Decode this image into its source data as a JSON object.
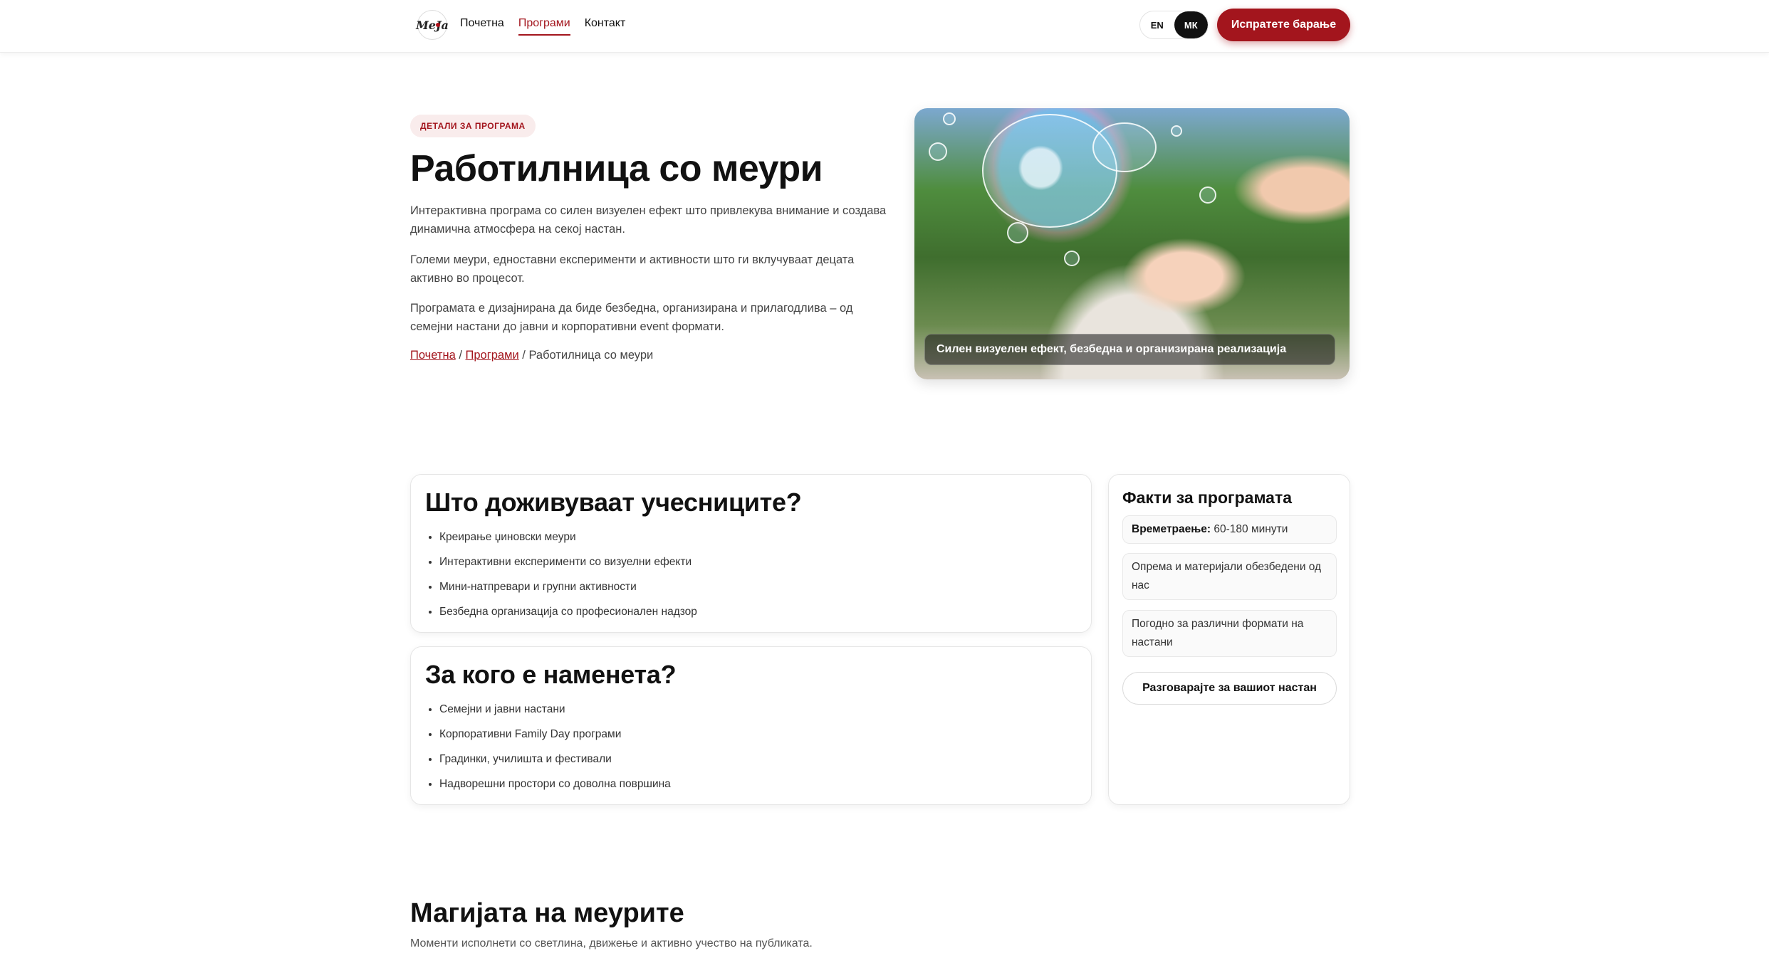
{
  "header": {
    "logo_text": "MeJa",
    "nav": [
      {
        "label": "Почетна",
        "active": false
      },
      {
        "label": "Програми",
        "active": true
      },
      {
        "label": "Контакт",
        "active": false
      }
    ],
    "lang": {
      "en": "EN",
      "mk": "МК",
      "selected": "МК"
    },
    "cta": "Испратете барање"
  },
  "hero": {
    "badge": "ДЕТАЛИ ЗА ПРОГРАМА",
    "title": "Работилница со меури",
    "p1": "Интерактивна програма со силен визуелен ефект што привлекува внимание и создава динамична атмосфера на секој настан.",
    "p2": "Големи меури, едноставни експерименти и активности што ги вклучуваат децата активно во процесот.",
    "p3": "Програмата е дизајнирана да биде безбедна, организирана и прилагодлива – од семејни настани до јавни и корпоративни event формати.",
    "breadcrumb": {
      "home": "Почетна",
      "sep": " / ",
      "programs": "Програми",
      "current": "Работилница со меури"
    },
    "image_caption": "Силен визуелен ефект, безбедна и организирана реализација"
  },
  "experience": {
    "title": "Што доживуваат учесниците?",
    "items": [
      "Креирање џиновски меури",
      "Интерактивни експерименти со визуелни ефекти",
      "Мини-натпревари и групни активности",
      "Безбедна организација со професионален надзор"
    ]
  },
  "audience": {
    "title": "За кого е наменета?",
    "items": [
      "Семејни и јавни настани",
      "Корпоративни Family Day програми",
      "Градинки, училишта и фестивали",
      "Надворешни простори со доволна површина"
    ]
  },
  "facts": {
    "title": "Факти за програмата",
    "duration_label": "Времетраење:",
    "duration_value": " 60-180 минути",
    "fact2": "Опрема и материјали обезбедени од нас",
    "fact3": "Погодно за различни формати на настани",
    "button": "Разговарајте за вашиот настан"
  },
  "magic": {
    "title": "Магијата на меурите",
    "subtitle": "Моменти исполнети со светлина, движење и активно учество на публиката."
  },
  "colors": {
    "accent": "#a3151d",
    "dark": "#111111"
  }
}
